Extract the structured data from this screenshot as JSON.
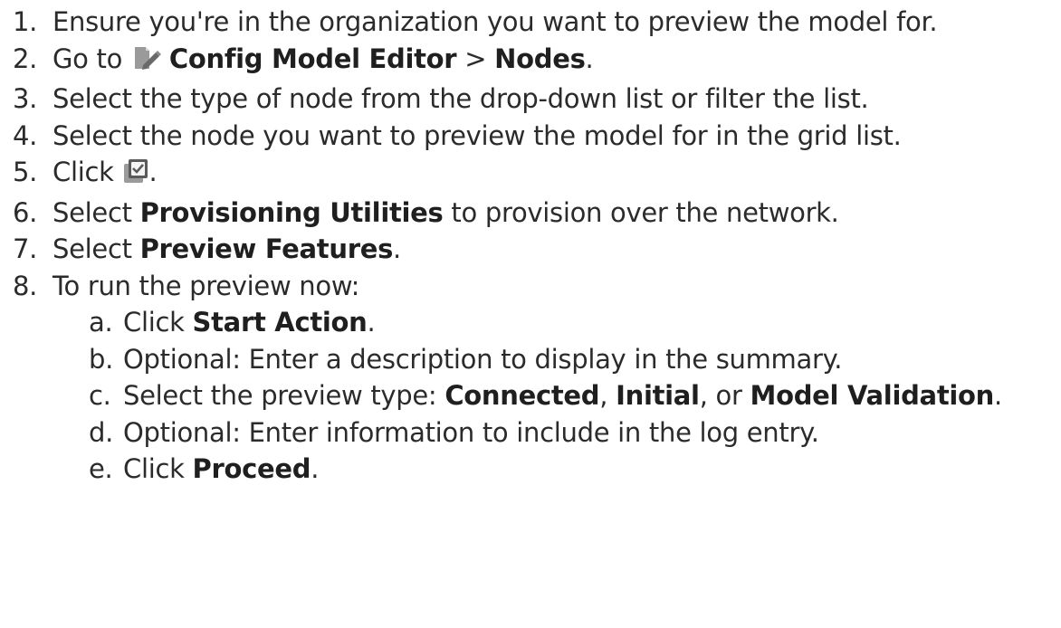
{
  "steps": [
    {
      "num": "1.",
      "text": "Ensure you're in the organization you want to preview the model for."
    },
    {
      "num": "2.",
      "pre": "Go to ",
      "icon": "config-model-editor-icon",
      "bold1": "Config Model Editor",
      "mid": " > ",
      "bold2": "Nodes",
      "post": "."
    },
    {
      "num": "3.",
      "text": "Select the type of node from the drop-down list or filter the list."
    },
    {
      "num": "4.",
      "text": "Select the node you want to preview the model for in the grid list."
    },
    {
      "num": "5.",
      "pre": "Click ",
      "icon": "preview-checkbox-icon",
      "post": "."
    },
    {
      "num": "6.",
      "pre": "Select ",
      "bold": "Provisioning Utilities",
      "post": " to provision over the network."
    },
    {
      "num": "7.",
      "pre": "Select ",
      "bold": "Preview Features",
      "post": "."
    },
    {
      "num": "8.",
      "text": "To run the preview now:"
    }
  ],
  "substeps": [
    {
      "num": "a.",
      "pre": "Click ",
      "bold": "Start Action",
      "post": "."
    },
    {
      "num": "b.",
      "text": "Optional: Enter a description to display in the summary."
    },
    {
      "num": "c.",
      "pre": "Select the preview type: ",
      "bold1": "Connected",
      "sep1": ", ",
      "bold2": "Initial",
      "sep2": ", or ",
      "bold3": "Model Validation",
      "post": "."
    },
    {
      "num": "d.",
      "text": "Optional: Enter information to include in the log entry."
    },
    {
      "num": "e.",
      "pre": "Click ",
      "bold": "Proceed",
      "post": "."
    }
  ],
  "colors": {
    "text": "#2b2b2b",
    "icon_gray": "#9a9a9a",
    "icon_dark": "#5a5a5a"
  }
}
